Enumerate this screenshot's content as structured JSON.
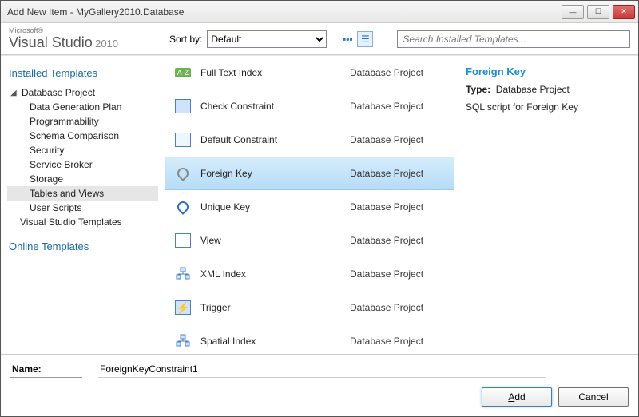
{
  "titlebar": {
    "text": "Add New Item - MyGallery2010.Database"
  },
  "brand": {
    "ms": "Microsoft®",
    "name": "Visual Studio",
    "year": "2010"
  },
  "toolbar": {
    "sort_label": "Sort by:",
    "sort_value": "Default",
    "search_placeholder": "Search Installed Templates..."
  },
  "sidebar": {
    "installed_heading": "Installed Templates",
    "online_heading": "Online Templates",
    "root": "Database Project",
    "children": [
      "Data Generation Plan",
      "Programmability",
      "Schema Comparison",
      "Security",
      "Service Broker",
      "Storage",
      "Tables and Views",
      "User Scripts"
    ],
    "vs_templates": "Visual Studio Templates"
  },
  "items": [
    {
      "label": "Full Text Index",
      "type": "Database Project"
    },
    {
      "label": "Check Constraint",
      "type": "Database Project"
    },
    {
      "label": "Default Constraint",
      "type": "Database Project"
    },
    {
      "label": "Foreign Key",
      "type": "Database Project"
    },
    {
      "label": "Unique Key",
      "type": "Database Project"
    },
    {
      "label": "View",
      "type": "Database Project"
    },
    {
      "label": "XML Index",
      "type": "Database Project"
    },
    {
      "label": "Trigger",
      "type": "Database Project"
    },
    {
      "label": "Spatial Index",
      "type": "Database Project"
    }
  ],
  "selected_index": 3,
  "details": {
    "title": "Foreign Key",
    "type_label": "Type:",
    "type_value": "Database Project",
    "desc": "SQL script for Foreign Key"
  },
  "footer": {
    "name_label": "Name:",
    "name_value": "ForeignKeyConstraint1",
    "add": "Add",
    "cancel": "Cancel"
  }
}
